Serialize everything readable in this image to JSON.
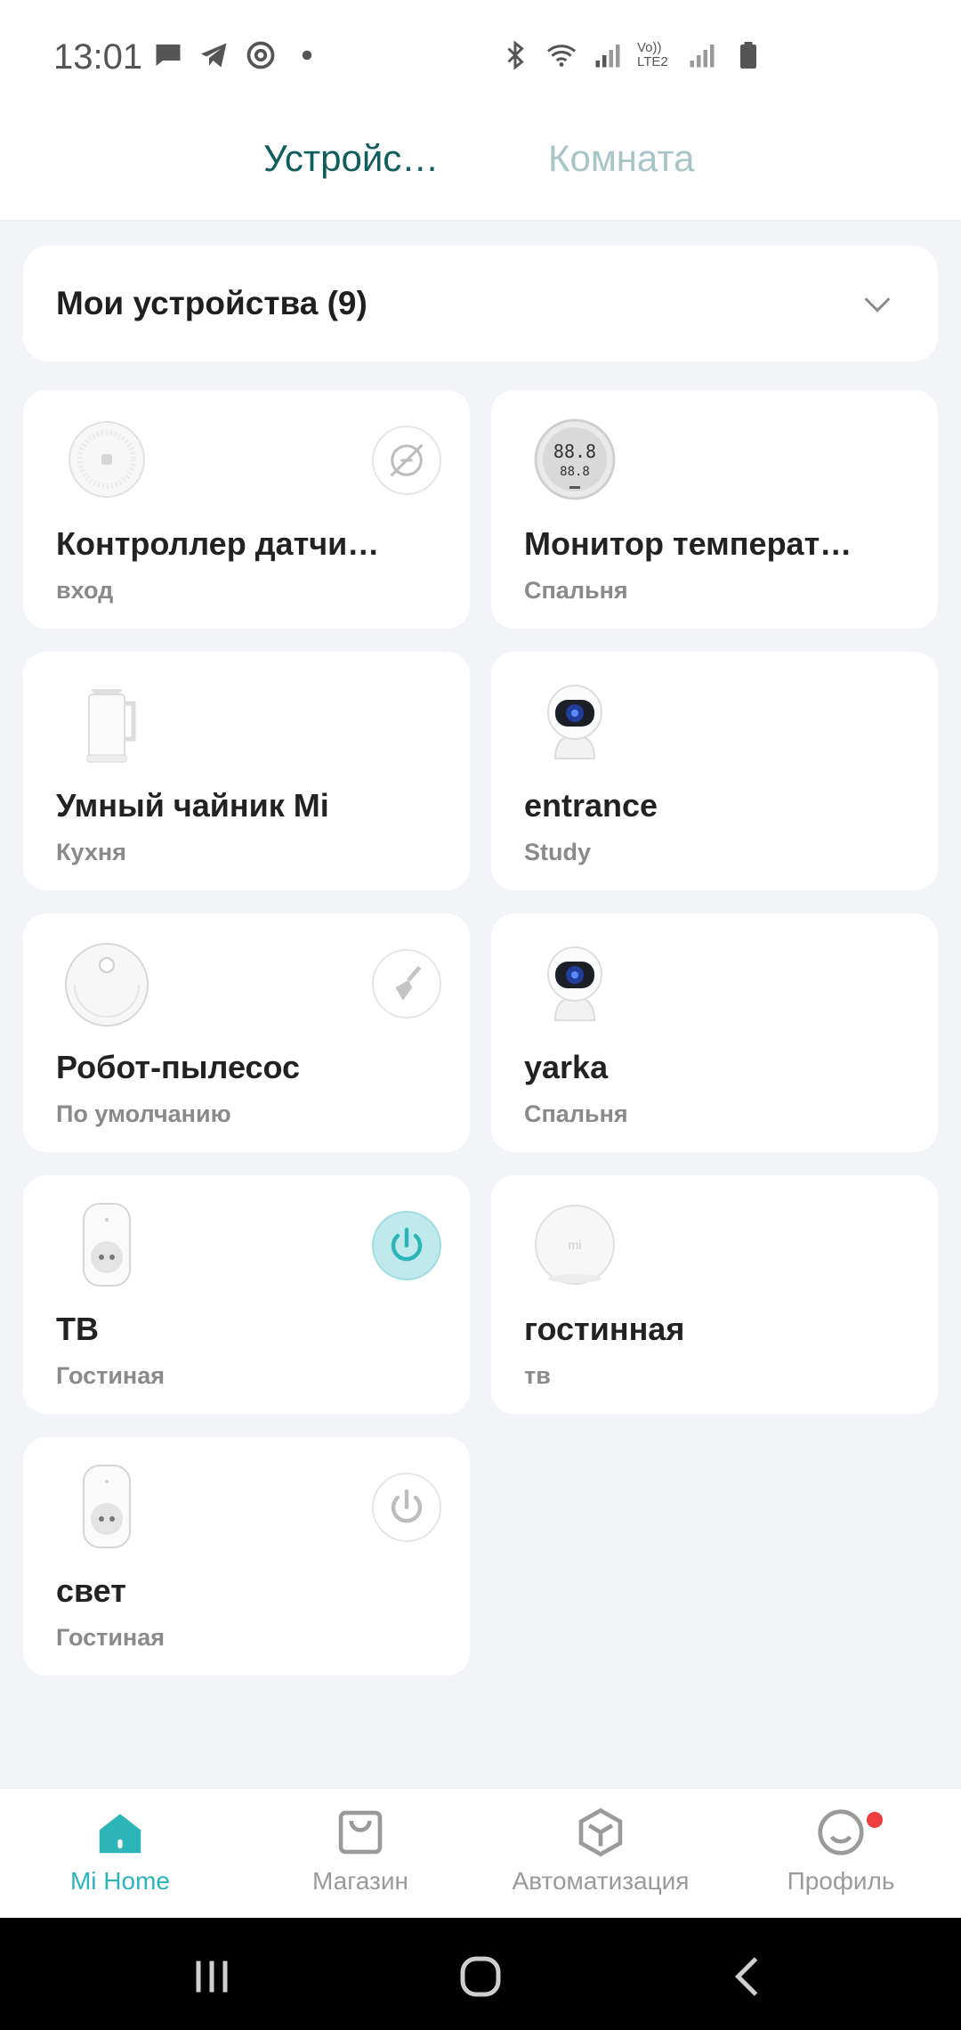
{
  "status_bar": {
    "time": "13:01",
    "left_icons": [
      "message-icon",
      "telegram-icon",
      "at-icon",
      "dot-icon"
    ],
    "right_icons": [
      "bluetooth-icon",
      "wifi-icon",
      "signal-icon",
      "volte-lte2-icon",
      "signal-icon",
      "battery-icon"
    ],
    "volte_label": "Vo)) LTE2"
  },
  "tabs": [
    {
      "label": "Устройс…",
      "active": true
    },
    {
      "label": "Комната",
      "active": false
    }
  ],
  "devices_section": {
    "title": "Мои устройства (9)",
    "expand_icon": "chevron-down-icon"
  },
  "devices": [
    {
      "name": "Контроллер датчи…",
      "room": "вход",
      "thumb": "gateway-hub",
      "action": "offline-icon"
    },
    {
      "name": "Монитор температ…",
      "room": "Спальня",
      "thumb": "temperature-monitor"
    },
    {
      "name": "Умный чайник Mi",
      "room": "Кухня",
      "thumb": "kettle"
    },
    {
      "name": "entrance",
      "room": "Study",
      "thumb": "camera"
    },
    {
      "name": "Робот-пылесос",
      "room": "По умолчанию",
      "thumb": "robot-vacuum",
      "action": "broom-icon"
    },
    {
      "name": "yarka",
      "room": "Спальня",
      "thumb": "camera"
    },
    {
      "name": "ТВ",
      "room": "Гостиная",
      "thumb": "smart-plug",
      "action": "power-icon",
      "action_on": true
    },
    {
      "name": "гостинная",
      "room": "тв",
      "thumb": "mi-button"
    },
    {
      "name": "свет",
      "room": "Гостиная",
      "thumb": "smart-plug",
      "action": "power-icon",
      "action_on": false
    }
  ],
  "bottom_nav": [
    {
      "label": "Mi Home",
      "icon": "home-icon",
      "active": true
    },
    {
      "label": "Магазин",
      "icon": "shop-bag-icon",
      "active": false
    },
    {
      "label": "Автоматизация",
      "icon": "automation-cube-icon",
      "active": false
    },
    {
      "label": "Профиль",
      "icon": "profile-smile-icon",
      "active": false,
      "badge": true
    }
  ],
  "colors": {
    "accent": "#2bb5b9",
    "tab_active": "#0f5d5c",
    "tab_inactive": "#a7c4c6",
    "background": "#f3f4f8",
    "badge": "#ee3d3d"
  },
  "system_nav": [
    "recent-apps-icon",
    "home-circle-icon",
    "back-icon"
  ]
}
